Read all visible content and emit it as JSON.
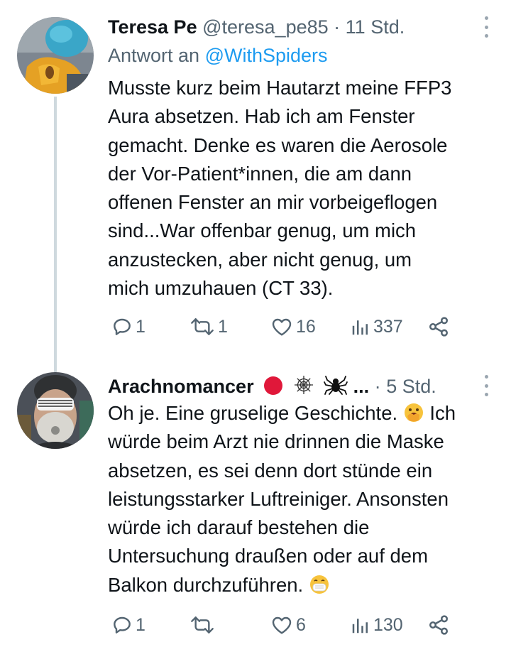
{
  "tweets": [
    {
      "display_name": "Teresa Pe",
      "handle": "@teresa_pe85",
      "separator": "·",
      "time": "11 Std.",
      "reply_prefix": "Antwort an",
      "reply_mention": "@WithSpiders",
      "text": "Musste kurz beim Hautarzt meine FFP3\nAura absetzen. Hab ich am Fenster\ngemacht. Denke es waren die Aerosole\nder Vor-Patient*innen, die am dann\noffenen Fenster an mir vorbeigeflogen\nsind...War offenbar genug, um mich\nanzustecken, aber nicht genug, um\nmich umzuhauen (CT 33).",
      "avatar_icon": "profile-photo-yellow-jacket",
      "actions": {
        "reply_count": "1",
        "retweet_count": "1",
        "like_count": "16",
        "view_count": "337"
      }
    },
    {
      "display_name": "Arachnomancer",
      "name_badges": [
        "red-circle-icon",
        "spider-web-icon",
        "spider-icon"
      ],
      "name_ellipsis": "...",
      "separator": "·",
      "time": "5 Std.",
      "text_part1": "Oh je. Eine gruselige Geschichte. ",
      "text_emoji1": "face-with-hand-over-mouth-emoji",
      "text_part2": " Ich\nwürde beim Arzt nie drinnen die Maske\nabsetzen, es sei denn dort stünde ein\nleistungsstarker Luftreiniger. Ansonsten\nwürde ich darauf bestehen die\nUntersuchung draußen oder auf dem\nBalkon durchzuführen. ",
      "text_emoji2": "face-with-medical-mask-emoji",
      "avatar_icon": "profile-photo-mask-glasses",
      "actions": {
        "reply_count": "1",
        "retweet_count": "",
        "like_count": "6",
        "view_count": "130"
      }
    }
  ],
  "colors": {
    "primary_text": "#0f1419",
    "secondary_text": "#536471",
    "link": "#1d9bf0",
    "thread_line": "#cfd9de",
    "badge_red": "#e0183a"
  }
}
